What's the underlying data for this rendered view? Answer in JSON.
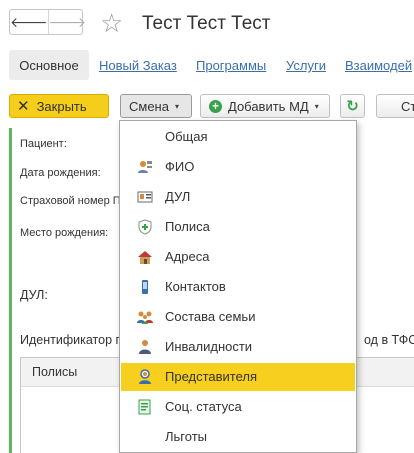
{
  "window": {
    "title": "Тест Тест Тест"
  },
  "nav": {
    "back": "🡐",
    "forward": "🡒",
    "star": "☆"
  },
  "tabs": {
    "active": "Основное",
    "links": [
      "Новый Заказ",
      "Программы",
      "Услуги",
      "Взаимодей"
    ]
  },
  "toolbar": {
    "close_icon": "✕",
    "close_label": "Закрыть",
    "shift_label": "Смена",
    "caret": "▾",
    "add_icon": "+",
    "add_label": "Добавить МД",
    "refresh_icon": "↻",
    "cut_label": "Ст"
  },
  "form": {
    "patient_label": "Пациент:",
    "birthdate_label": "Дата рождения:",
    "insurance_label": "Страховой номер П",
    "birthplace_label": "Место рождения:",
    "dul_label": "ДУЛ:",
    "identifier_label": "Идентификатор п",
    "tfoms_label": "од в ТФС",
    "policies_header": "Полисы"
  },
  "menu": {
    "items": [
      {
        "label": "Общая",
        "icon": "none"
      },
      {
        "label": "ФИО",
        "icon": "person-card-icon"
      },
      {
        "label": "ДУЛ",
        "icon": "id-card-icon"
      },
      {
        "label": "Полиса",
        "icon": "shield-icon"
      },
      {
        "label": "Адреса",
        "icon": "house-icon"
      },
      {
        "label": "Контактов",
        "icon": "phone-icon"
      },
      {
        "label": "Состава семьи",
        "icon": "family-icon"
      },
      {
        "label": "Инвалидности",
        "icon": "person-icon"
      },
      {
        "label": "Представителя",
        "icon": "representative-icon"
      },
      {
        "label": "Соц. статуса",
        "icon": "document-icon"
      },
      {
        "label": "Льготы",
        "icon": "none"
      }
    ],
    "selected": "Представителя"
  },
  "colors": {
    "accent": "#f7cf1f",
    "link": "#3b6fa8",
    "form_line": "#5cb85c"
  }
}
